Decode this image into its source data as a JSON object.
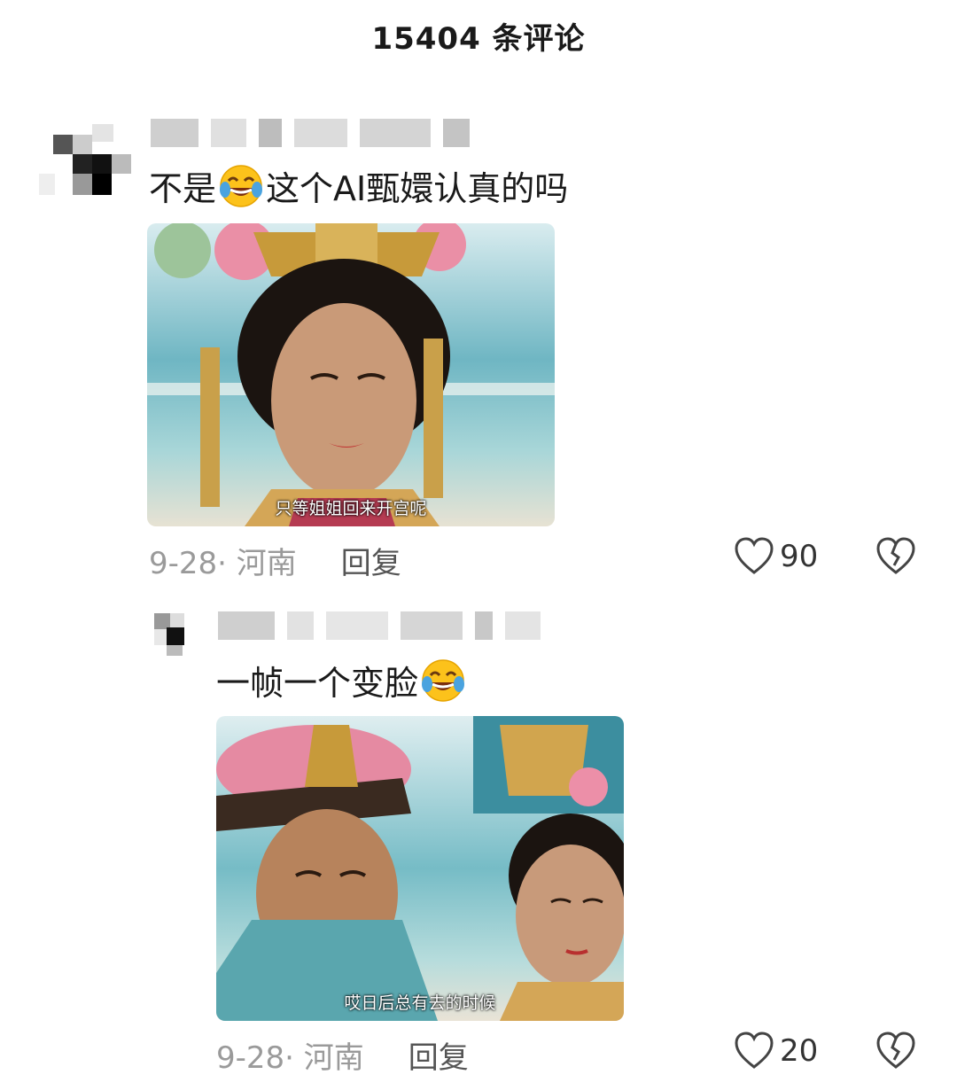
{
  "header": {
    "title": "15404 条评论"
  },
  "comments": [
    {
      "text_before": "不是",
      "text_after": "这个AI甄嬛认真的吗",
      "emoji": "laughing-crying-emoji",
      "image_caption": "只等姐姐回来开宫呢",
      "date_location": "9-28· 河南",
      "reply_label": "回复",
      "likes": "90"
    },
    {
      "text_before": "一帧一个变脸",
      "text_after": "",
      "emoji": "laughing-crying-emoji",
      "image_caption": "哎日后总有去的时候",
      "date_location": "9-28· 河南",
      "reply_label": "回复",
      "likes": "20"
    }
  ],
  "icons": {
    "like": "heart-outline-icon",
    "dislike": "broken-heart-icon"
  },
  "colors": {
    "text": "#1a1a1a",
    "meta": "#9a9a9a",
    "sea": "#7fc3c9"
  }
}
